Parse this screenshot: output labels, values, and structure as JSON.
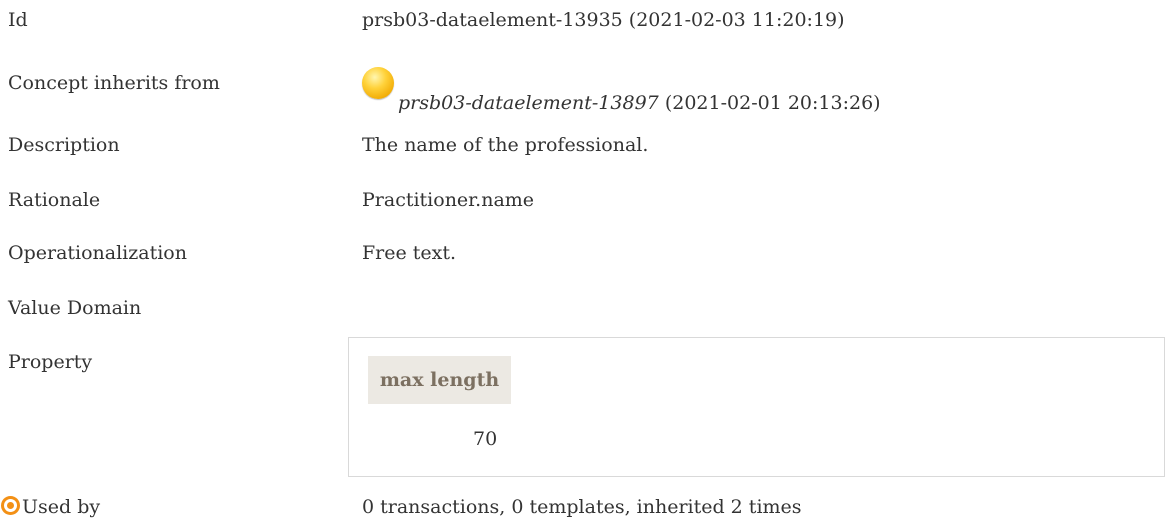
{
  "rows": {
    "id": {
      "label": "Id",
      "value": "prsb03-dataelement-13935 (2021-02-03 11:20:19)"
    },
    "inherits": {
      "label": "Concept inherits from",
      "concept_id": "prsb03-dataelement-13897",
      "concept_date": "(2021-02-01 20:13:26)",
      "icon": "yellow-ball-icon"
    },
    "description": {
      "label": "Description",
      "value": "The name of the professional."
    },
    "rationale": {
      "label": "Rationale",
      "value": "Practitioner.name"
    },
    "operationalization": {
      "label": "Operationalization",
      "value": "Free text."
    },
    "value_domain": {
      "label": "Value Domain"
    },
    "property": {
      "label": "Property",
      "header": "max length",
      "value": "70"
    },
    "used_by": {
      "label": "Used by",
      "icon": "target-icon",
      "value": "0 transactions, 0 templates, inherited 2 times"
    }
  },
  "colors": {
    "text": "#333333",
    "header_bg": "#ece9e3",
    "header_text": "#7c7061",
    "icon_orange": "#f39015",
    "ball_yellow": "#ffd23a"
  }
}
